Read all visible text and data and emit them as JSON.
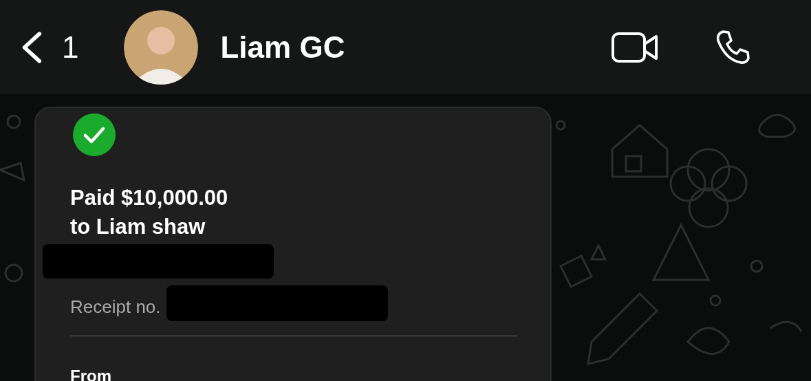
{
  "header": {
    "back_count": "1",
    "contact_name": "Liam GC"
  },
  "receipt": {
    "title_lines": [
      "Paid $10,000.00",
      "to Liam shaw"
    ],
    "receipt_label": "Receipt no.",
    "from_label": "From"
  }
}
